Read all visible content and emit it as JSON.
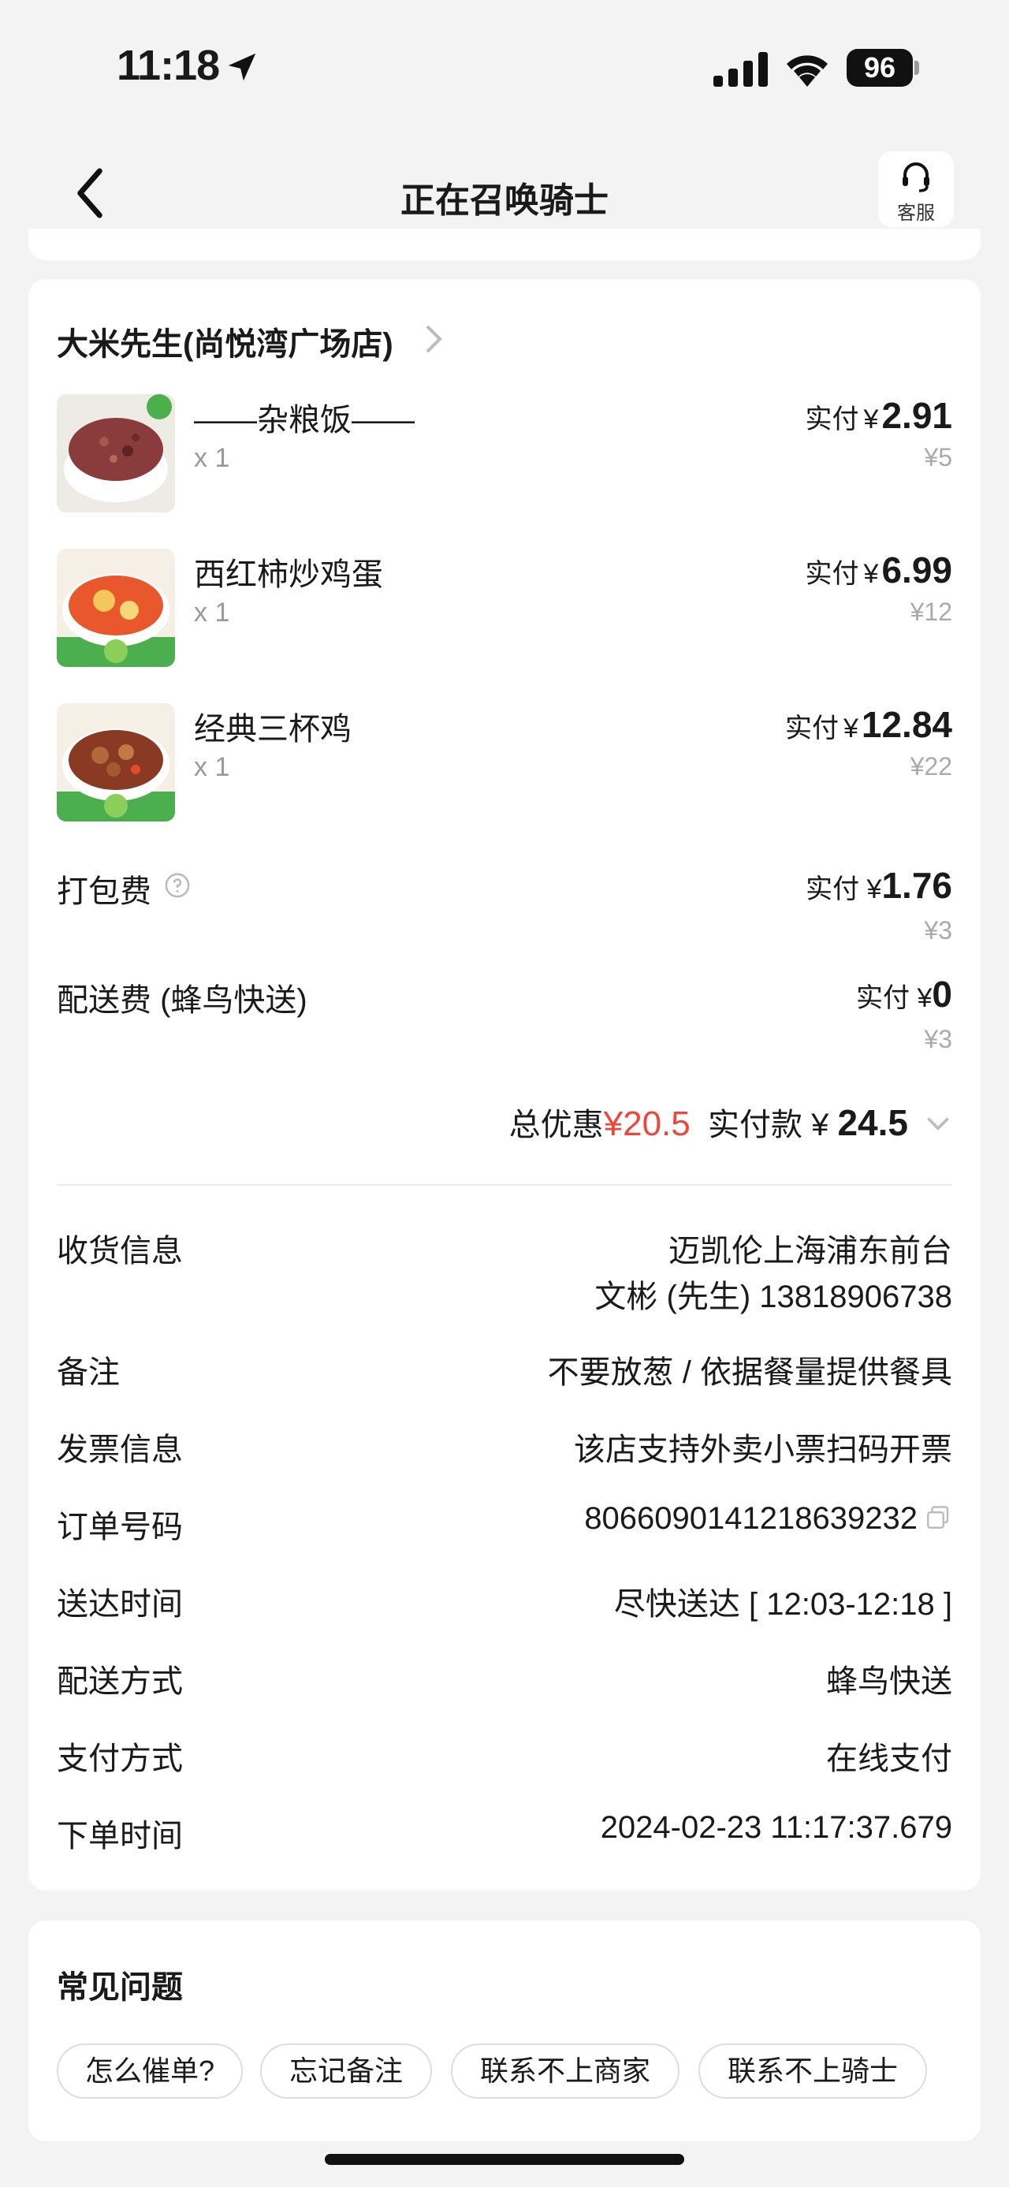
{
  "status_bar": {
    "time": "11:18",
    "battery": "96"
  },
  "header": {
    "title": "正在召唤骑士",
    "service_label": "客服"
  },
  "store": {
    "name": "大米先生(尚悦湾广场店)"
  },
  "items": [
    {
      "name": "——杂粮饭——",
      "qty": "x 1",
      "paid_label": "实付",
      "currency": "¥",
      "paid": "2.91",
      "original": "¥5",
      "thumb_color": "#8a3b3b"
    },
    {
      "name": "西红柿炒鸡蛋",
      "qty": "x 1",
      "paid_label": "实付",
      "currency": "¥",
      "paid": "6.99",
      "original": "¥12",
      "thumb_color": "#e8582c"
    },
    {
      "name": "经典三杯鸡",
      "qty": "x 1",
      "paid_label": "实付",
      "currency": "¥",
      "paid": "12.84",
      "original": "¥22",
      "thumb_color": "#8a3a22"
    }
  ],
  "fees": [
    {
      "label": "打包费",
      "paid_label": "实付",
      "currency": "¥",
      "paid": "1.76",
      "original": "¥3"
    },
    {
      "label": "配送费 (蜂鸟快送)",
      "paid_label": "实付",
      "currency": "¥",
      "paid": "0",
      "original": "¥3"
    }
  ],
  "summary": {
    "discount_label": "总优惠",
    "discount": "¥20.5",
    "total_label": "实付款",
    "currency": "¥",
    "total": "24.5"
  },
  "info": {
    "address_label": "收货信息",
    "address_line1": "迈凯伦上海浦东前台",
    "address_line2": "文彬 (先生) 13818906738",
    "note_label": "备注",
    "note": "不要放葱 / 依据餐量提供餐具",
    "invoice_label": "发票信息",
    "invoice": "该店支持外卖小票扫码开票",
    "order_no_label": "订单号码",
    "order_no": "8066090141218639232",
    "delivery_time_label": "送达时间",
    "delivery_time": "尽快送达 [ 12:03-12:18 ]",
    "delivery_method_label": "配送方式",
    "delivery_method": "蜂鸟快送",
    "payment_label": "支付方式",
    "payment": "在线支付",
    "order_time_label": "下单时间",
    "order_time": "2024-02-23 11:17:37.679"
  },
  "faq": {
    "title": "常见问题",
    "chips": [
      "怎么催单?",
      "忘记备注",
      "联系不上商家",
      "联系不上骑士"
    ]
  },
  "colors": {
    "accent_red": "#f0453a",
    "background": "#f3f3f3",
    "card": "#ffffff"
  }
}
